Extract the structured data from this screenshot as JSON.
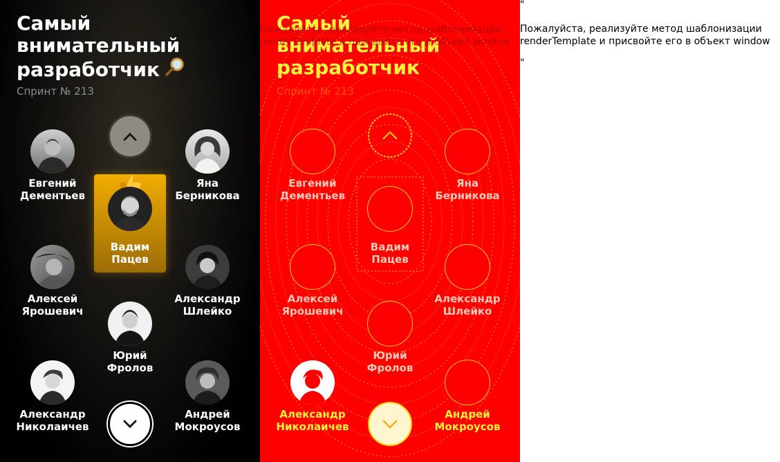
{
  "slide": {
    "title": "Самый внимательный разработчик",
    "title_emoji": "magnifier-icon",
    "subtitle": "Спринт № 213"
  },
  "people": [
    {
      "first": "Евгений",
      "last": "Дементьев"
    },
    {
      "first": "Яна",
      "last": "Берникова"
    },
    {
      "first": "Вадим",
      "last": "Пацев"
    },
    {
      "first": "Алексей",
      "last": "Ярошевич"
    },
    {
      "first": "Александр",
      "last": "Шлейко"
    },
    {
      "first": "Юрий",
      "last": "Фролов"
    },
    {
      "first": "Александр",
      "last": "Николаичев"
    },
    {
      "first": "Андрей",
      "last": "Мокроусов"
    }
  ],
  "leader_emoji": "thumbs-up-icon",
  "error": {
    "message": "Пожалуйста, реализуйте метод шаблонизации renderTemplate и присвойте его в объект window",
    "quote_open": "\"",
    "quote_close": "\""
  },
  "colors": {
    "accent": "#f1ad00",
    "glitch_bg": "#ff0000",
    "glitch_fg": "#fff23a"
  }
}
